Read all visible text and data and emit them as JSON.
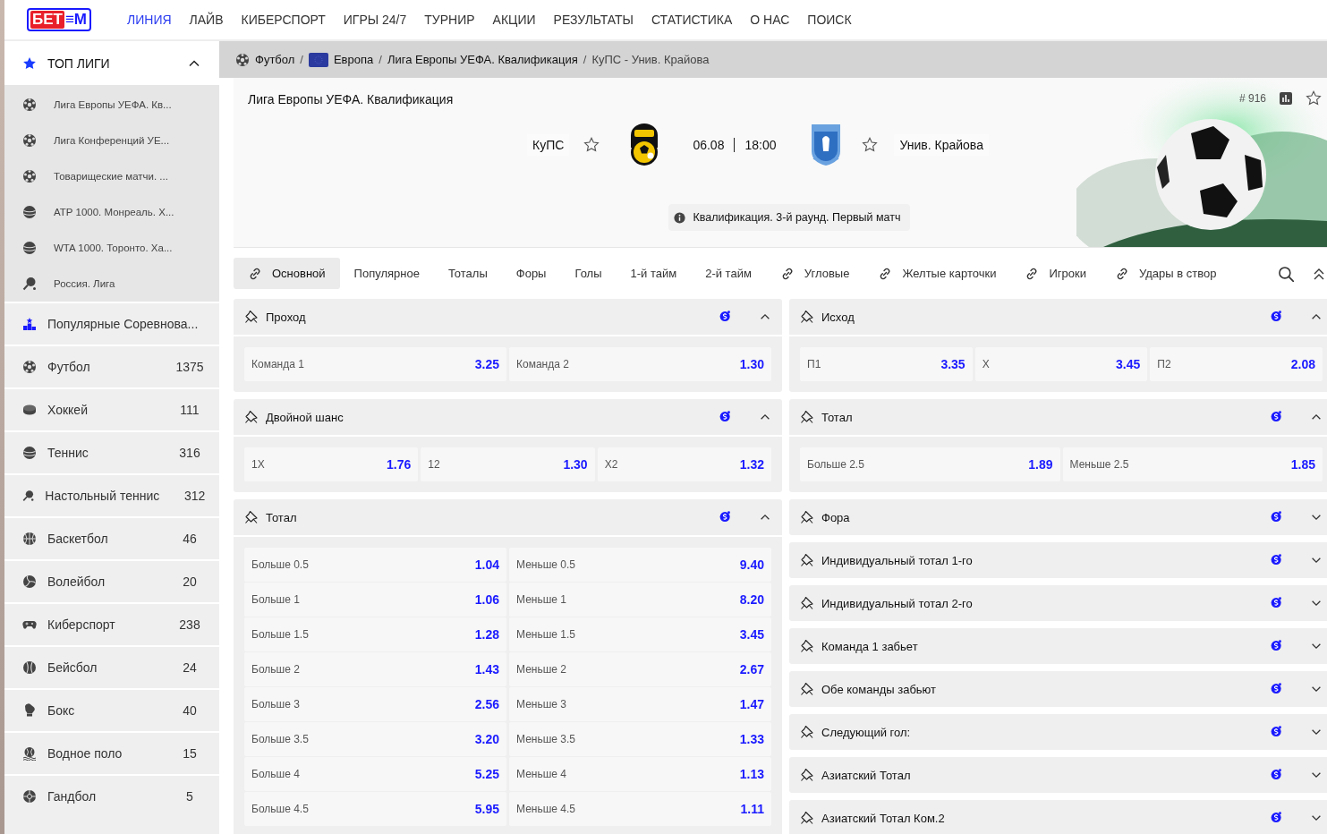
{
  "logo": {
    "part_1": "БЕТ",
    "part_2": "≡М"
  },
  "nav": [
    {
      "label": "ЛИНИЯ",
      "selected": true
    },
    {
      "label": "ЛАЙВ",
      "selected": false
    },
    {
      "label": "КИБЕРСПОРТ",
      "selected": false
    },
    {
      "label": "ИГРЫ 24/7",
      "selected": false
    },
    {
      "label": "ТУРНИР",
      "selected": false
    },
    {
      "label": "АКЦИИ",
      "selected": false
    },
    {
      "label": "РЕЗУЛЬТАТЫ",
      "selected": false
    },
    {
      "label": "СТАТИСТИКА",
      "selected": false
    },
    {
      "label": "О НАС",
      "selected": false
    },
    {
      "label": "ПОИСК",
      "selected": false
    }
  ],
  "sidebar": {
    "top_leagues": {
      "title": "ТОП ЛИГИ",
      "expanded": true,
      "items": [
        {
          "kind": "soccer",
          "label": "Лига Европы УЕФА. Кв..."
        },
        {
          "kind": "soccer",
          "label": "Лига Конференций УЕ..."
        },
        {
          "kind": "soccer",
          "label": "Товарищеские матчи. ..."
        },
        {
          "kind": "tennis",
          "label": "ATP 1000. Монреаль. Х..."
        },
        {
          "kind": "tennis",
          "label": "WTA 1000. Торонто. Ха..."
        },
        {
          "kind": "table-tennis",
          "label": "Россия. Лига"
        }
      ]
    },
    "sports": [
      {
        "kind": "podium",
        "label": "Популярные Соревнова..."
      },
      {
        "kind": "soccer",
        "label": "Футбол",
        "count": "1375"
      },
      {
        "kind": "hockey",
        "label": "Хоккей",
        "count": "111"
      },
      {
        "kind": "tennis",
        "label": "Теннис",
        "count": "316"
      },
      {
        "kind": "table-tennis",
        "label": "Настольный теннис",
        "count": "312"
      },
      {
        "kind": "basketball",
        "label": "Баскетбол",
        "count": "46"
      },
      {
        "kind": "volleyball",
        "label": "Волейбол",
        "count": "20"
      },
      {
        "kind": "esports",
        "label": "Киберспорт",
        "count": "238"
      },
      {
        "kind": "baseball",
        "label": "Бейсбол",
        "count": "24"
      },
      {
        "kind": "boxing",
        "label": "Бокс",
        "count": "40"
      },
      {
        "kind": "water-polo",
        "label": "Водное поло",
        "count": "15"
      },
      {
        "kind": "handball",
        "label": "Гандбол",
        "count": "5"
      }
    ]
  },
  "breadcrumb": [
    {
      "kind": "soccer",
      "label": "Футбол",
      "current": false
    },
    {
      "separator": "/",
      "kind": "flag",
      "label": "Европа",
      "current": false
    },
    {
      "separator": "/",
      "label": "Лига Европы УЕФА. Квалификация",
      "current": false
    },
    {
      "separator": "/",
      "label": "КуПС - Унив. Крайова",
      "current": true
    }
  ],
  "event": {
    "league": "Лига Европы УЕФА. Квалификация",
    "home": {
      "name": "КуПС",
      "favorite": false
    },
    "date": "06.08",
    "time": "18:00",
    "away": {
      "name": "Унив. Крайова",
      "favorite": false
    },
    "info": "Квалификация. 3-й раунд. Первый матч",
    "number": "# 916",
    "favorite": false
  },
  "tabs": [
    {
      "label": "Основной",
      "linked": true,
      "selected": true
    },
    {
      "label": "Популярное",
      "linked": false,
      "selected": false
    },
    {
      "label": "Тоталы",
      "linked": false,
      "selected": false
    },
    {
      "label": "Форы",
      "linked": false,
      "selected": false
    },
    {
      "label": "Голы",
      "linked": false,
      "selected": false
    },
    {
      "label": "1-й тайм",
      "linked": false,
      "selected": false
    },
    {
      "label": "2-й тайм",
      "linked": false,
      "selected": false
    },
    {
      "label": "Угловые",
      "linked": true,
      "selected": false
    },
    {
      "label": "Желтые карточки",
      "linked": true,
      "selected": false
    },
    {
      "label": "Игроки",
      "linked": true,
      "selected": false
    },
    {
      "label": "Удары в створ",
      "linked": true,
      "selected": false
    }
  ],
  "markets": {
    "left": [
      {
        "title": "Проход",
        "expanded": true,
        "rows": [
          [
            {
              "label": "Команда 1",
              "odd": "3.25"
            },
            {
              "label": "Команда 2",
              "odd": "1.30"
            }
          ]
        ]
      },
      {
        "title": "Двойной шанс",
        "expanded": true,
        "rows": [
          [
            {
              "label": "1X",
              "odd": "1.76"
            },
            {
              "label": "12",
              "odd": "1.30"
            },
            {
              "label": "X2",
              "odd": "1.32"
            }
          ]
        ]
      },
      {
        "title": "Тотал",
        "expanded": true,
        "rows": [
          [
            {
              "label": "Больше 0.5",
              "odd": "1.04"
            },
            {
              "label": "Меньше 0.5",
              "odd": "9.40"
            }
          ],
          [
            {
              "label": "Больше 1",
              "odd": "1.06"
            },
            {
              "label": "Меньше 1",
              "odd": "8.20"
            }
          ],
          [
            {
              "label": "Больше 1.5",
              "odd": "1.28"
            },
            {
              "label": "Меньше 1.5",
              "odd": "3.45"
            }
          ],
          [
            {
              "label": "Больше 2",
              "odd": "1.43"
            },
            {
              "label": "Меньше 2",
              "odd": "2.67"
            }
          ],
          [
            {
              "label": "Больше 3",
              "odd": "2.56"
            },
            {
              "label": "Меньше 3",
              "odd": "1.47"
            }
          ],
          [
            {
              "label": "Больше 3.5",
              "odd": "3.20"
            },
            {
              "label": "Меньше 3.5",
              "odd": "1.33"
            }
          ],
          [
            {
              "label": "Больше 4",
              "odd": "5.25"
            },
            {
              "label": "Меньше 4",
              "odd": "1.13"
            }
          ],
          [
            {
              "label": "Больше 4.5",
              "odd": "5.95"
            },
            {
              "label": "Меньше 4.5",
              "odd": "1.11"
            }
          ]
        ]
      }
    ],
    "right": [
      {
        "title": "Исход",
        "expanded": true,
        "rows": [
          [
            {
              "label": "П1",
              "odd": "3.35"
            },
            {
              "label": "X",
              "odd": "3.45"
            },
            {
              "label": "П2",
              "odd": "2.08"
            }
          ]
        ]
      },
      {
        "title": "Тотал",
        "expanded": true,
        "rows": [
          [
            {
              "label": "Больше 2.5",
              "odd": "1.89"
            },
            {
              "label": "Меньше 2.5",
              "odd": "1.85"
            }
          ]
        ]
      },
      {
        "title": "Фора",
        "expanded": false
      },
      {
        "title": "Индивидуальный тотал 1-го",
        "expanded": false
      },
      {
        "title": "Индивидуальный тотал 2-го",
        "expanded": false
      },
      {
        "title": "Команда 1 забьет",
        "expanded": false
      },
      {
        "title": "Обе команды забьют",
        "expanded": false
      },
      {
        "title": "Следующий гол:",
        "expanded": false
      },
      {
        "title": "Азиатский Тотал",
        "expanded": false
      },
      {
        "title": "Азиатский Тотал Ком.2",
        "expanded": false
      }
    ]
  }
}
